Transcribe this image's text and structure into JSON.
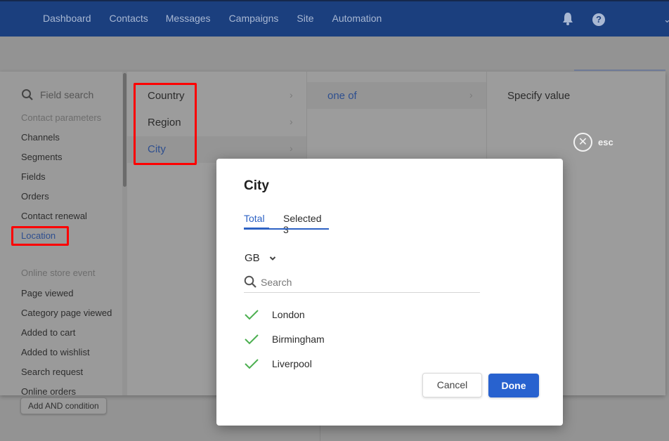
{
  "topnav": {
    "items": [
      "Dashboard",
      "Contacts",
      "Messages",
      "Campaigns",
      "Site",
      "Automation"
    ],
    "icons": [
      "bell-icon",
      "help-icon"
    ],
    "brand_color": "#1b3f7e"
  },
  "picker": {
    "field_search_label": "Field search",
    "sections": [
      {
        "title": "Contact parameters",
        "items": [
          "Channels",
          "Segments",
          "Fields",
          "Orders",
          "Contact renewal",
          "Location"
        ]
      },
      {
        "title": "Online store event",
        "items": [
          "Page viewed",
          "Category page viewed",
          "Added to cart",
          "Added to wishlist",
          "Search request",
          "Online orders"
        ]
      }
    ],
    "active_item": "Location",
    "location_fields": [
      "Country",
      "Region",
      "City"
    ],
    "active_field": "City",
    "operators": [
      "one of"
    ],
    "active_operator": "one of",
    "value_column_title": "Specify value",
    "esc_label": "esc"
  },
  "add_condition_label": "Add AND condition",
  "modal": {
    "title": "City",
    "tabs": [
      {
        "label": "Total",
        "active": true
      },
      {
        "label": "Selected 3",
        "active": false
      }
    ],
    "country_select": "GB",
    "search_placeholder": "Search",
    "search_value": "",
    "cities": [
      {
        "name": "London",
        "checked": true
      },
      {
        "name": "Birmingham",
        "checked": true
      },
      {
        "name": "Liverpool",
        "checked": true
      }
    ],
    "cancel_label": "Cancel",
    "done_label": "Done",
    "accent_color": "#2862cf",
    "check_color": "#4caf50"
  }
}
